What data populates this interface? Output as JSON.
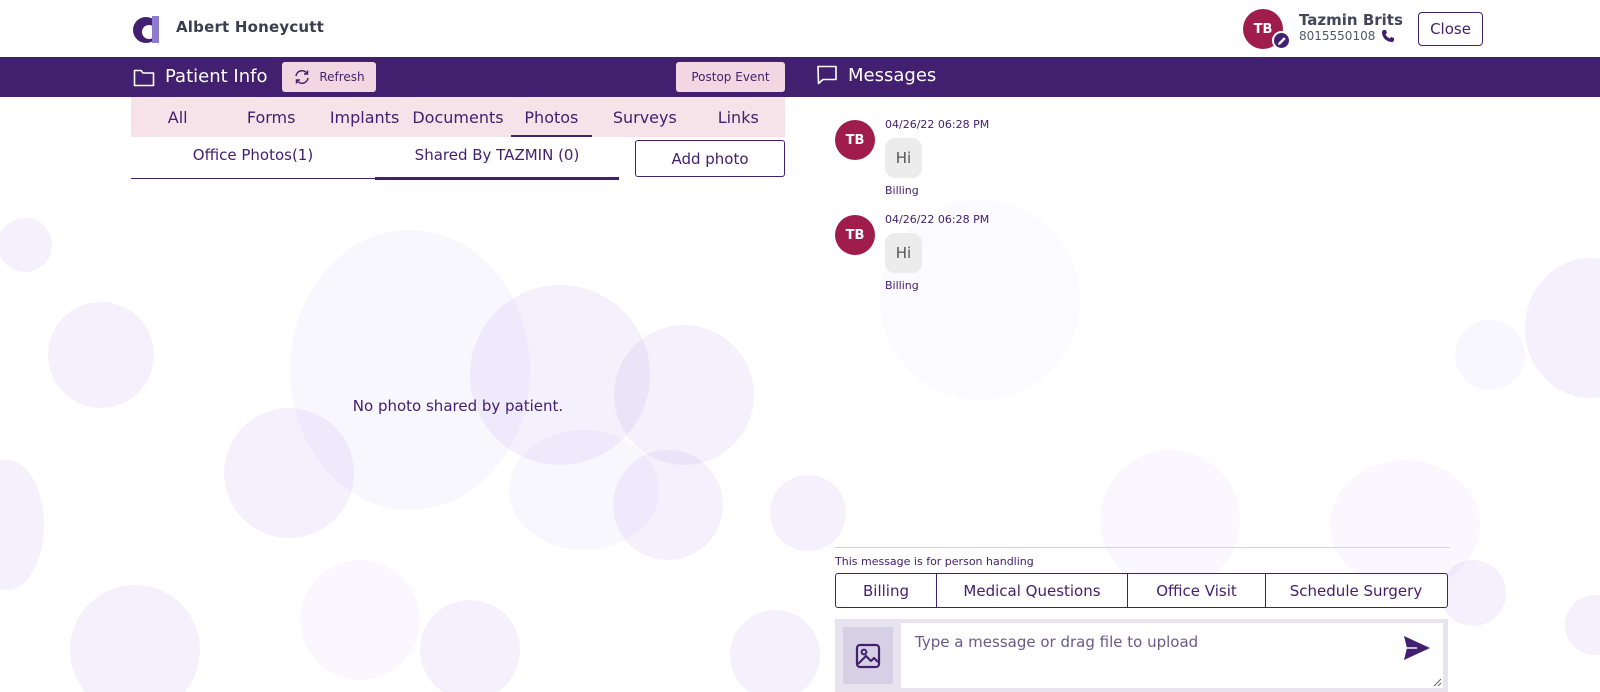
{
  "header": {
    "user_name": "Albert Honeycutt",
    "patient_initials": "TB",
    "patient_name": "Tazmin Brits",
    "patient_phone": "8015550108",
    "close_label": "Close"
  },
  "patient_info": {
    "title": "Patient Info",
    "refresh_label": "Refresh",
    "postop_label": "Postop Event",
    "tabs": [
      {
        "label": "All",
        "active": false
      },
      {
        "label": "Forms",
        "active": false
      },
      {
        "label": "Implants",
        "active": false
      },
      {
        "label": "Documents",
        "active": false
      },
      {
        "label": "Photos",
        "active": true
      },
      {
        "label": "Surveys",
        "active": false
      },
      {
        "label": "Links",
        "active": false
      }
    ],
    "subtabs": [
      {
        "label": "Office Photos(1)",
        "active": false
      },
      {
        "label": "Shared By TAZMIN (0)",
        "active": true
      }
    ],
    "add_photo_label": "Add photo",
    "empty_message": "No photo shared by patient."
  },
  "messages": {
    "title": "Messages",
    "items": [
      {
        "initials": "TB",
        "time": "04/26/22 06:28 PM",
        "text": "Hi",
        "tag": "Billing"
      },
      {
        "initials": "TB",
        "time": "04/26/22 06:28 PM",
        "text": "Hi",
        "tag": "Billing"
      }
    ],
    "handler_note": "This message is for person handling",
    "handlers": [
      "Billing",
      "Medical Questions",
      "Office Visit",
      "Schedule Surgery"
    ],
    "input_placeholder": "Type a message or drag file to upload"
  },
  "colors": {
    "brand_purple": "#43206f",
    "avatar_red": "#a01d4b",
    "tab_background": "#f6e3ea",
    "button_pink": "#f2d7e3"
  },
  "icons": [
    "logo-icon",
    "edit-icon",
    "phone-icon",
    "folder-icon",
    "refresh-icon",
    "chat-icon",
    "image-icon",
    "send-icon"
  ]
}
